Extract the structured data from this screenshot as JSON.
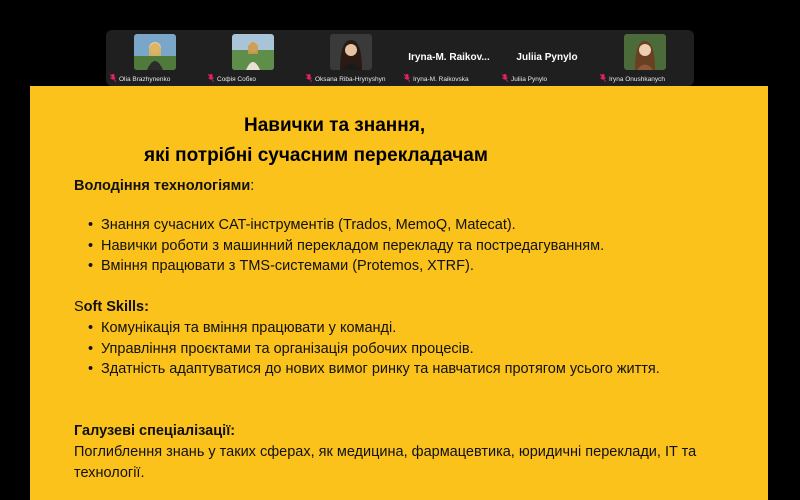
{
  "participants": [
    {
      "label": "Olia Brazhynenko",
      "display": "photo"
    },
    {
      "label": "Софія Собко",
      "display": "photo"
    },
    {
      "label": "Oksana Riba-Hrynyshyn",
      "display": "photo"
    },
    {
      "label": "Iryna-M. Raikovska",
      "display": "name",
      "big_name": "Iryna-M.  Raikov..."
    },
    {
      "label": "Juliia Pynylo",
      "display": "name",
      "big_name": "Juliia Pynylo"
    },
    {
      "label": "Iryna Onushkanych",
      "display": "photo"
    }
  ],
  "slide": {
    "title_line1": "Навички та знання,",
    "title_line2": "які потрібні сучасним перекладачам",
    "tech": {
      "heading": "Володіння технологіями",
      "heading_suffix": ":",
      "items": [
        "Знання сучасних CAT-інструментів (Trados, MemoQ, Matecat).",
        "Навички роботи з машинний перекладом перекладу та постредагуванням.",
        "Вміння працювати з TMS-системами (Protemos, XTRF)."
      ]
    },
    "soft": {
      "heading_first": "S",
      "heading_rest": "oft Skills:",
      "items": [
        "Комунікація та вміння працювати у команді.",
        "Управління проєктами та організація робочих процесів.",
        "Здатність адаптуватися до нових вимог ринку та навчатися протягом усього життя."
      ]
    },
    "industry": {
      "heading": "Галузеві спеціалізації:",
      "text": "Поглиблення знань у таких сферах, як медицина, фармацевтика, юридичні переклади, IT та технології."
    }
  },
  "colors": {
    "slide_background": "#fbc21c",
    "muted_mic": "#e0245e",
    "strip_background": "#1f1f1f"
  }
}
